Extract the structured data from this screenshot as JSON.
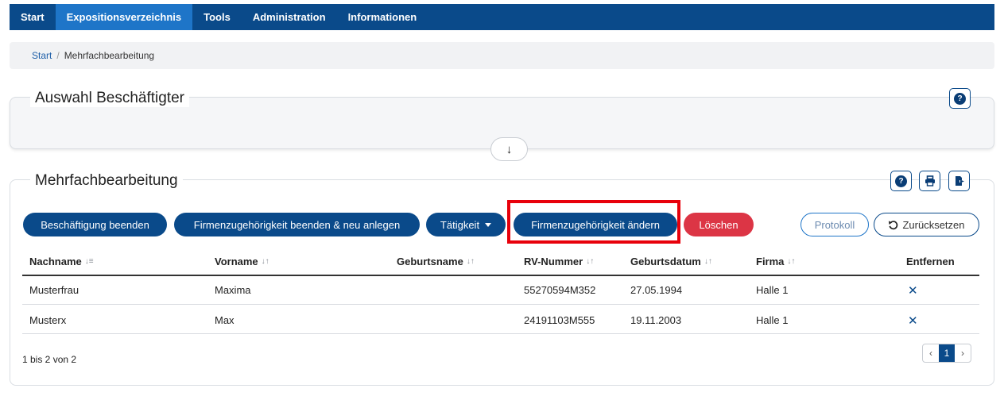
{
  "nav": {
    "items": [
      "Start",
      "Expositionsverzeichnis",
      "Tools",
      "Administration",
      "Informationen"
    ],
    "active_index": 1
  },
  "breadcrumb": {
    "home": "Start",
    "separator": "/",
    "current": "Mehrfachbearbeitung"
  },
  "section1": {
    "title": "Auswahl Beschäftigter",
    "help_icon": "question-circle-icon",
    "expand_icon": "arrow-down-icon",
    "expand_glyph": "↓"
  },
  "section2": {
    "title": "Mehrfachbearbeitung",
    "icons": [
      "question-circle-icon",
      "printer-icon",
      "export-icon"
    ],
    "buttons": {
      "end_employment": "Beschäftigung beenden",
      "end_company_new": "Firmenzugehörigkeit beenden & neu anlegen",
      "activity": "Tätigkeit",
      "change_company": "Firmenzugehörigkeit ändern",
      "delete": "Löschen",
      "protocol": "Protokoll",
      "reset": "Zurücksetzen",
      "reset_icon": "undo-icon"
    },
    "table": {
      "headers": [
        "Nachname",
        "Vorname",
        "Geburtsname",
        "RV-Nummer",
        "Geburtsdatum",
        "Firma",
        "Entfernen"
      ],
      "rows": [
        {
          "nachname": "Musterfrau",
          "vorname": "Maxima",
          "geburtsname": "",
          "rv": "55270594M352",
          "geburtsdatum": "27.05.1994",
          "firma": "Halle 1",
          "remove": "✕"
        },
        {
          "nachname": "Musterx",
          "vorname": "Max",
          "geburtsname": "",
          "rv": "24191103M555",
          "geburtsdatum": "19.11.2003",
          "firma": "Halle 1",
          "remove": "✕"
        }
      ]
    },
    "footer": {
      "info": "1 bis 2 von 2",
      "pager": {
        "prev": "‹",
        "current": "1",
        "next": "›"
      }
    }
  },
  "colors": {
    "primary": "#0a4a8a",
    "active_nav": "#1e75c8",
    "danger": "#dc3545",
    "highlight": "#e8000b"
  }
}
